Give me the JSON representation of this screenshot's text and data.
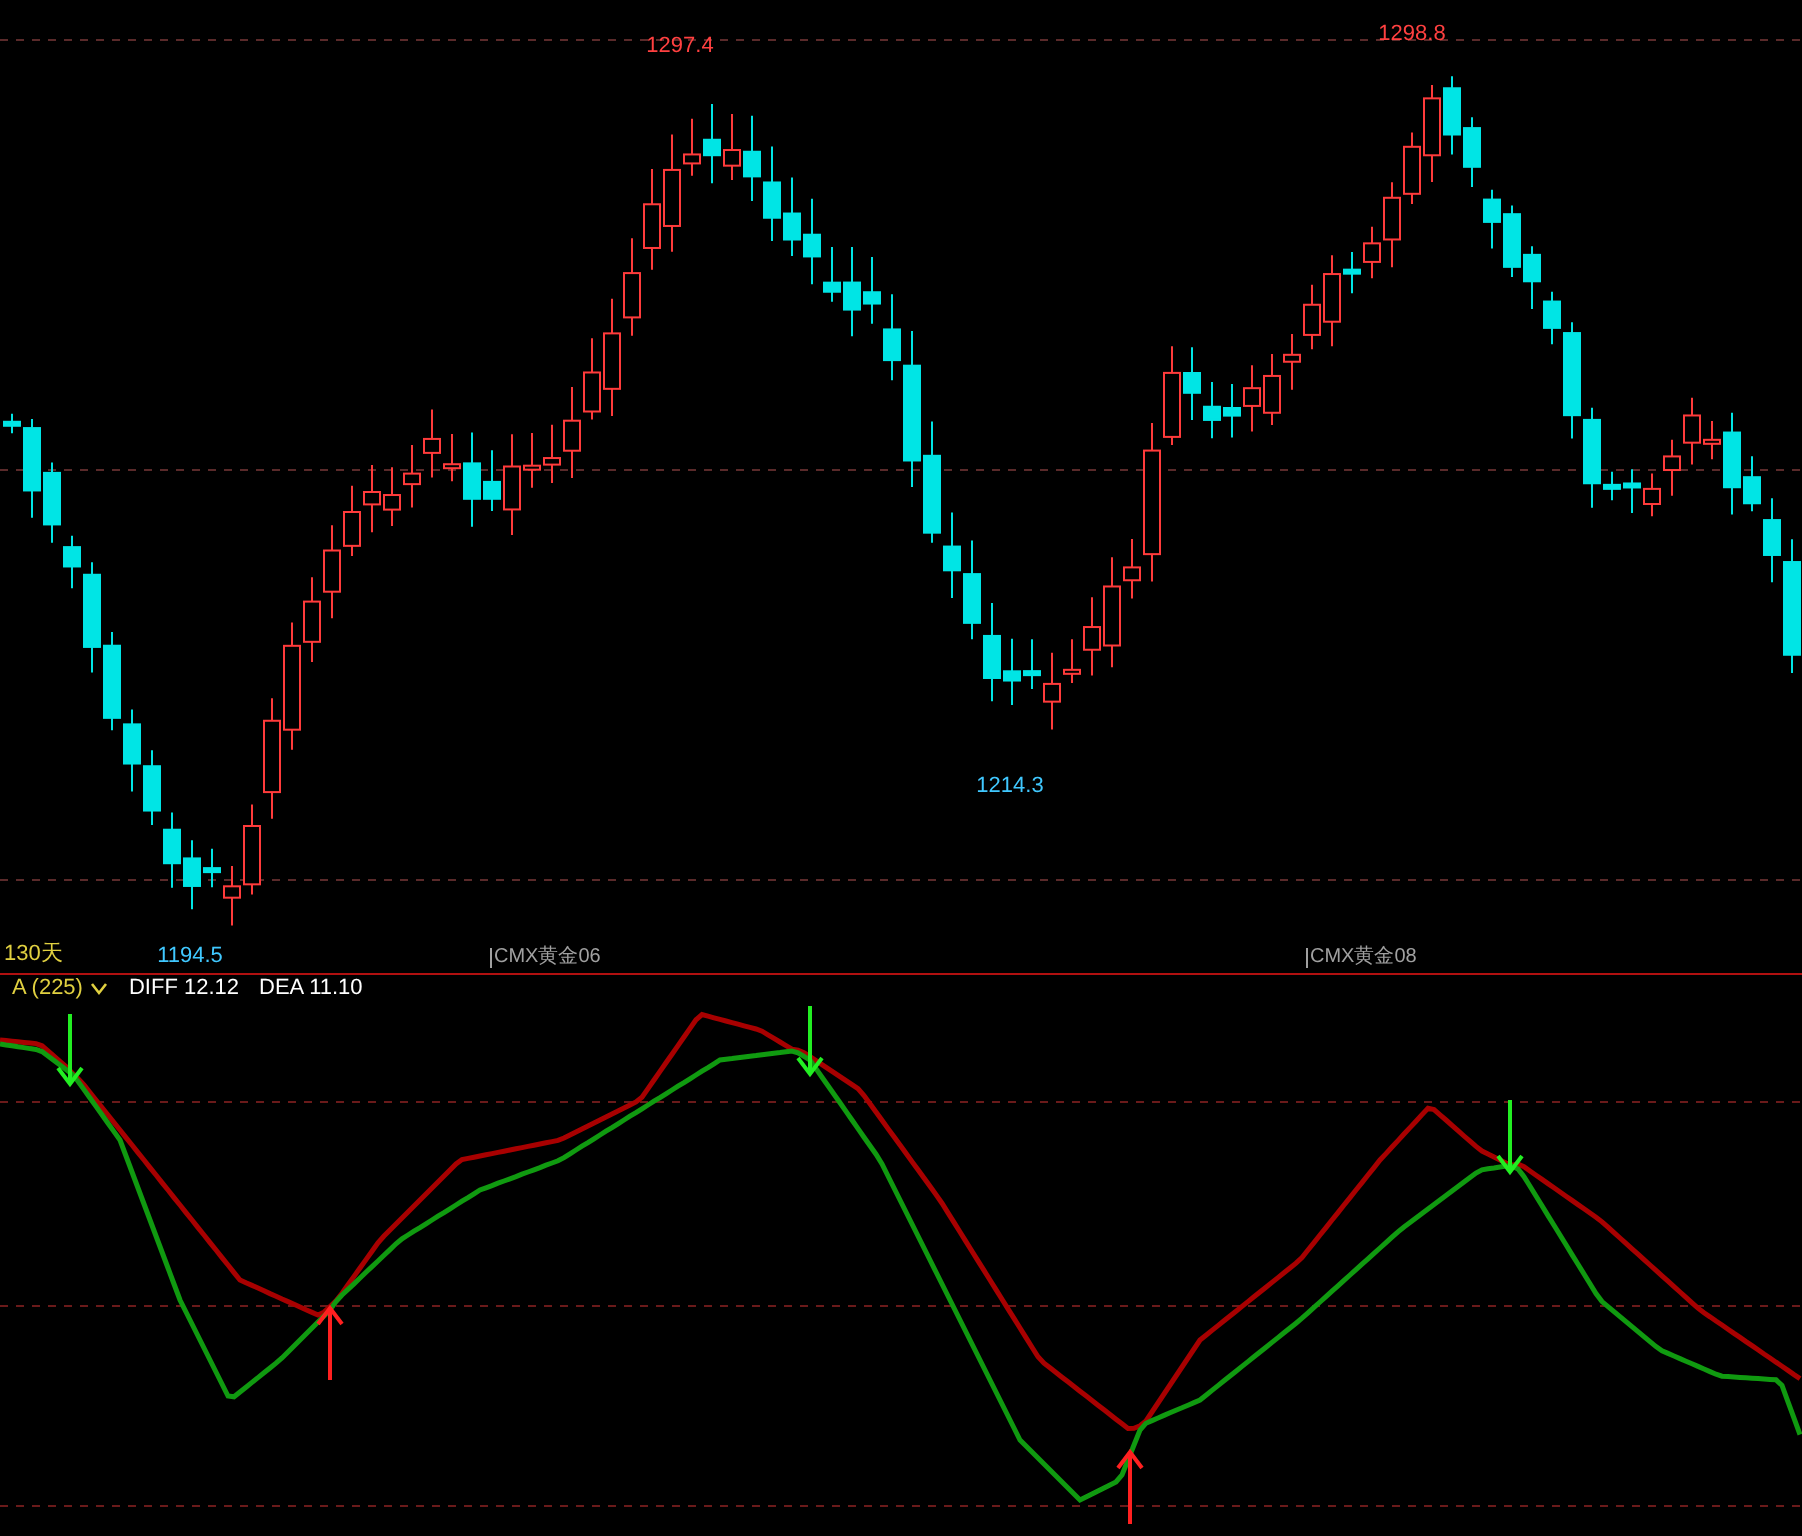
{
  "price_panel": {
    "labels": [
      {
        "text": "1297.4",
        "kind": "high"
      },
      {
        "text": "1298.8",
        "kind": "high"
      },
      {
        "text": "1214.3",
        "kind": "low"
      },
      {
        "text": "1194.5",
        "kind": "low"
      }
    ],
    "period": "130天",
    "contracts": [
      "CMX黄金06",
      "CMX黄金08"
    ]
  },
  "indicator_panel": {
    "name": "A (225)",
    "diff": "DIFF 12.12",
    "dea": "DEA 11.10"
  }
}
